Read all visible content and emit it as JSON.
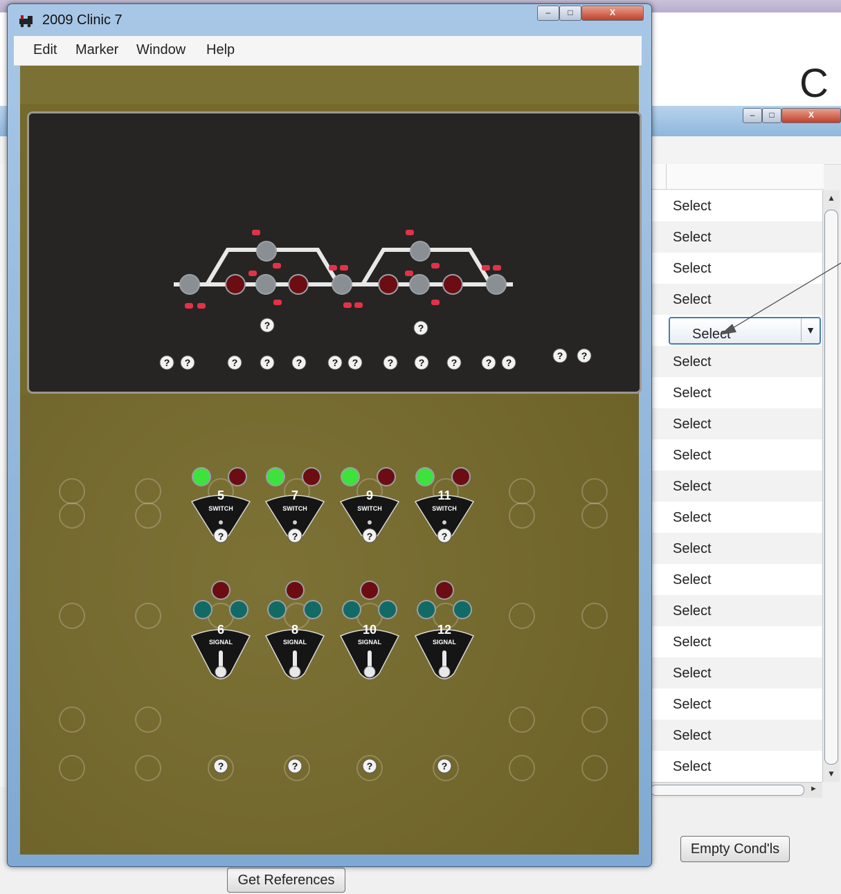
{
  "slide": {
    "title_fragment": "C"
  },
  "background_window": {
    "controls": {
      "minimize": "–",
      "maximize": "□",
      "close": "X"
    },
    "rows": [
      "Select",
      "Select",
      "Select",
      "Select",
      "Select",
      "Select",
      "Select",
      "Select",
      "Select",
      "Select",
      "Select",
      "Select",
      "Select",
      "Select",
      "Select",
      "Select",
      "Select",
      "Select",
      "Select"
    ],
    "selected_index": 4,
    "buttons": {
      "empty_condls": "Empty Cond'ls",
      "get_references": "Get References"
    }
  },
  "foreground_window": {
    "title": "2009 Clinic 7",
    "controls": {
      "minimize": "–",
      "maximize": "□",
      "close": "X"
    },
    "menu": [
      "Edit",
      "Marker",
      "Window",
      "Help"
    ],
    "switch_numbers": [
      "5",
      "7",
      "9",
      "11"
    ],
    "signal_numbers": [
      "6",
      "8",
      "10",
      "12"
    ],
    "switch_label": "SWITCH",
    "signal_label": "SIGNAL",
    "unknown_glyph": "?"
  },
  "colors": {
    "panel_olive": "#75692b",
    "panel_dark": "#262523",
    "lamp_green": "#3de23d",
    "lamp_red": "#6b0d12",
    "lamp_teal": "#136a64",
    "selection_blue": "#4d7fae"
  }
}
